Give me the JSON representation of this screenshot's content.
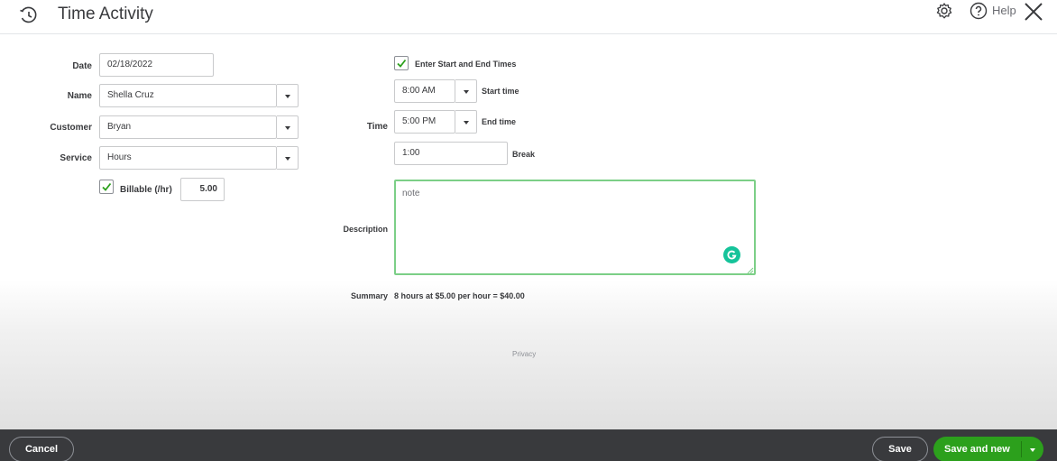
{
  "header": {
    "title": "Time Activity",
    "help_label": "Help"
  },
  "form": {
    "date": {
      "label": "Date",
      "value": "02/18/2022"
    },
    "name": {
      "label": "Name",
      "value": "Shella Cruz"
    },
    "customer": {
      "label": "Customer",
      "value": "Bryan"
    },
    "service": {
      "label": "Service",
      "value": "Hours"
    },
    "billable": {
      "label": "Billable (/hr)",
      "checked": true,
      "rate": "5.00"
    },
    "enter_times": {
      "label": "Enter Start and End Times",
      "checked": true
    },
    "time_label": "Time",
    "start_time": {
      "value": "8:00 AM",
      "label": "Start time"
    },
    "end_time": {
      "value": "5:00 PM",
      "label": "End time"
    },
    "break": {
      "value": "1:00",
      "label": "Break"
    },
    "description": {
      "label": "Description",
      "value": "note"
    },
    "summary": {
      "label": "Summary",
      "text": "8 hours at $5.00 per hour = $40.00"
    },
    "privacy": "Privacy"
  },
  "footer": {
    "cancel_label": "Cancel",
    "save_label": "Save",
    "save_new_label": "Save and new"
  },
  "colors": {
    "brand_green": "#2ca01c",
    "footer_bg": "#393a3d",
    "focus_green": "#7ccf87",
    "grammarly": "#15c39a"
  },
  "icons": {
    "history": "history-icon",
    "settings": "gear-icon",
    "help": "help-icon",
    "close": "close-icon",
    "grammarly": "grammarly-icon"
  }
}
